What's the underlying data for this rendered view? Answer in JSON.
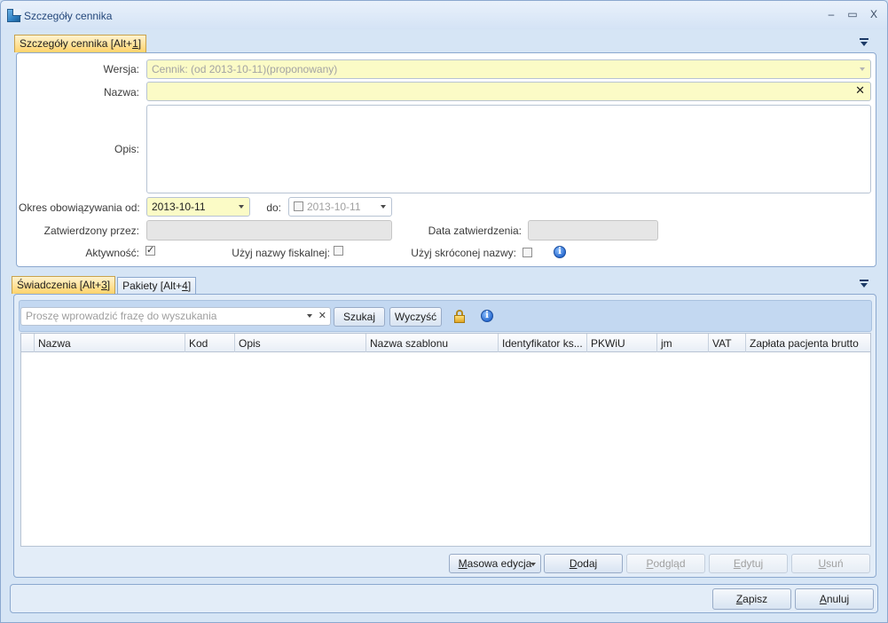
{
  "window": {
    "title": "Szczegóły cennika",
    "minimize": "–",
    "maximize": "▭",
    "close": "X"
  },
  "details_tab": {
    "label_pre": "Szczegóły cennika [Alt+",
    "label_key": "1",
    "label_post": "]"
  },
  "form": {
    "wersja_label": "Wersja:",
    "wersja_value": "Cennik:  (od 2013-10-11)(proponowany)",
    "nazwa_label": "Nazwa:",
    "nazwa_value": "",
    "nazwa_clear": "✕",
    "opis_label": "Opis:",
    "opis_value": "",
    "okres_label": "Okres obowiązywania od:",
    "okres_od_value": "2013-10-11",
    "do_label": "do:",
    "okres_do_value": "2013-10-11",
    "zatwierdzony_label": "Zatwierdzony przez:",
    "zatwierdzony_value": "",
    "data_zatw_label": "Data zatwierdzenia:",
    "data_zatw_value": "",
    "aktywnosc_label": "Aktywność:",
    "aktywnosc_checked": true,
    "fiskalna_label": "Użyj nazwy fiskalnej:",
    "fiskalna_checked": false,
    "skrocona_label": "Użyj skróconej nazwy:",
    "skrocona_checked": false
  },
  "lower_tabs": [
    {
      "pre": "Świadczenia [Alt+",
      "key": "3",
      "post": "]",
      "active": true
    },
    {
      "pre": "Pakiety [Alt+",
      "key": "4",
      "post": "]",
      "active": false
    }
  ],
  "search": {
    "placeholder": "Proszę wprowadzić frazę do wyszukania",
    "value": "",
    "clear": "✕",
    "search_button": "Szukaj",
    "clear_button": "Wyczyść"
  },
  "grid": {
    "columns": [
      "Nazwa",
      "Kod",
      "Opis",
      "Nazwa szablonu",
      "Identyfikator ks...",
      "PKWiU",
      "jm",
      "VAT",
      "Zapłata pacjenta brutto"
    ],
    "rows": []
  },
  "grid_actions": {
    "masowa_pre": "",
    "masowa_key": "M",
    "masowa_post": "asowa edycja",
    "dodaj_key": "D",
    "dodaj_post": "odaj",
    "podglad_key": "P",
    "podglad_post": "odgląd",
    "edytuj_key": "E",
    "edytuj_post": "dytuj",
    "usun_key": "U",
    "usun_post": "suń"
  },
  "footer": {
    "zapisz_key": "Z",
    "zapisz_post": "apisz",
    "anuluj_key": "A",
    "anuluj_post": "nuluj"
  }
}
